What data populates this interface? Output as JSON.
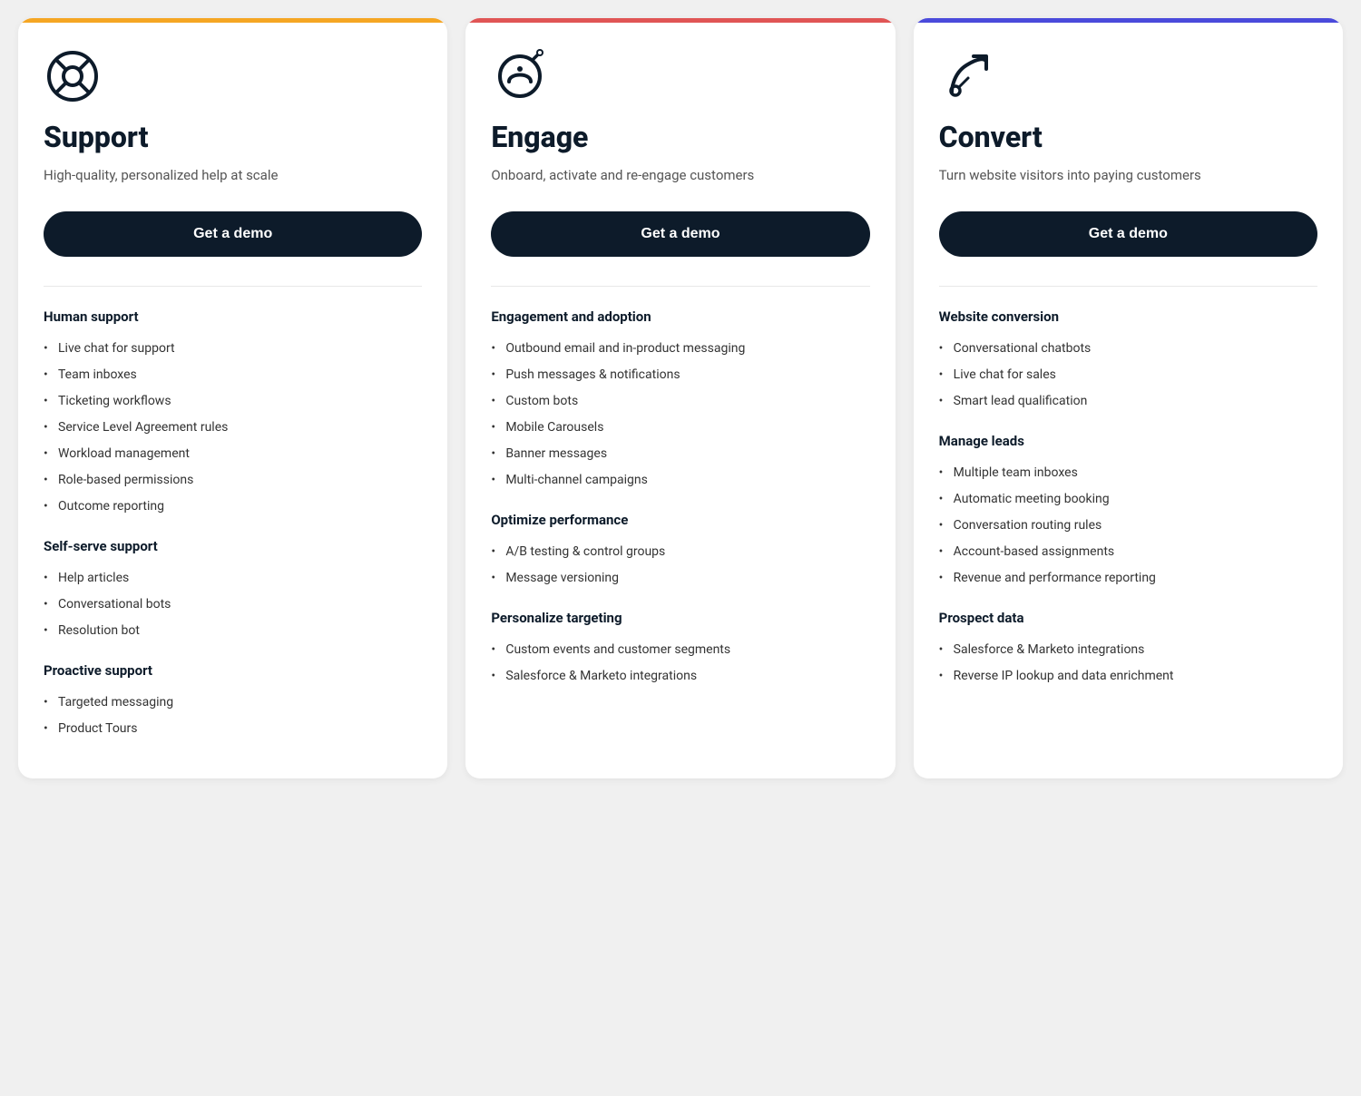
{
  "cards": [
    {
      "id": "support",
      "icon": "support-icon",
      "title": "Support",
      "description": "High-quality, personalized help at scale",
      "button_label": "Get a demo",
      "accent_color": "#f5a623",
      "sections": [
        {
          "heading": "Human support",
          "items": [
            "Live chat for support",
            "Team inboxes",
            "Ticketing workflows",
            "Service Level Agreement rules",
            "Workload management",
            "Role-based permissions",
            "Outcome reporting"
          ]
        },
        {
          "heading": "Self-serve support",
          "items": [
            "Help articles",
            "Conversational bots",
            "Resolution bot"
          ]
        },
        {
          "heading": "Proactive support",
          "items": [
            "Targeted messaging",
            "Product Tours"
          ]
        }
      ]
    },
    {
      "id": "engage",
      "icon": "engage-icon",
      "title": "Engage",
      "description": "Onboard, activate and re-engage customers",
      "button_label": "Get a demo",
      "accent_color": "#e05555",
      "sections": [
        {
          "heading": "Engagement and adoption",
          "items": [
            "Outbound email and in-product messaging",
            "Push messages & notifications",
            "Custom bots",
            "Mobile Carousels",
            "Banner messages",
            "Multi-channel campaigns"
          ]
        },
        {
          "heading": "Optimize performance",
          "items": [
            "A/B testing & control groups",
            "Message versioning"
          ]
        },
        {
          "heading": "Personalize targeting",
          "items": [
            "Custom events and customer segments",
            "Salesforce & Marketo integrations"
          ]
        }
      ]
    },
    {
      "id": "convert",
      "icon": "convert-icon",
      "title": "Convert",
      "description": "Turn website visitors into paying customers",
      "button_label": "Get a demo",
      "accent_color": "#4a4adb",
      "sections": [
        {
          "heading": "Website conversion",
          "items": [
            "Conversational chatbots",
            "Live chat for sales",
            "Smart lead qualification"
          ]
        },
        {
          "heading": "Manage leads",
          "items": [
            "Multiple team inboxes",
            "Automatic meeting booking",
            "Conversation routing rules",
            "Account-based assignments",
            "Revenue and performance reporting"
          ]
        },
        {
          "heading": "Prospect data",
          "items": [
            "Salesforce & Marketo integrations",
            "Reverse IP lookup and data enrichment"
          ]
        }
      ]
    }
  ]
}
